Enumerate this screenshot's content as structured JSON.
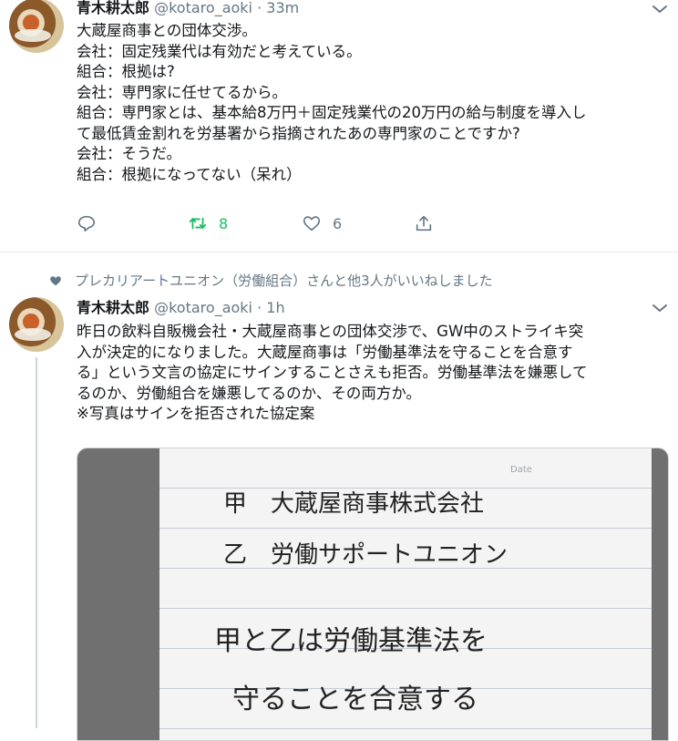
{
  "tweet1": {
    "name": "青木耕太郎",
    "handle": "@kotaro_aoki",
    "separator": "·",
    "time": "33m",
    "lines": [
      "大蔵屋商事との団体交渉。",
      "会社：固定残業代は有効だと考えている。",
      "組合：根拠は?",
      "会社：専門家に任せてるから。",
      "組合：専門家とは、基本給8万円＋固定残業代の20万円の給与制度を導入し",
      "て最低賃金割れを労基署から指摘されたあの専門家のことですか?",
      "会社：そうだ。",
      "組合：根拠になってない（呆れ）"
    ],
    "retweet_count": "8",
    "like_count": "6",
    "icons": [
      "chevron-down-icon",
      "reply-icon",
      "retweet-icon",
      "heart-icon",
      "share-icon"
    ],
    "retweet_color": "#17bf63"
  },
  "social_context": {
    "text": "プレカリアートユニオン（労働組合）さんと他3人がいいねしました",
    "icon": "heart-filled-icon"
  },
  "tweet2": {
    "name": "青木耕太郎",
    "handle": "@kotaro_aoki",
    "separator": "·",
    "time": "1h",
    "lines": [
      "昨日の飲料自販機会社・大蔵屋商事との団体交渉で、GW中のストライキ突",
      "入が決定的になりました。大蔵屋商事は「労働基準法を守ることを合意す",
      "る」という文言の協定にサインすることさえも拒否。労働基準法を嫌悪して",
      "るのか、労働組合を嫌悪してるのか、その両方か。",
      "※写真はサインを拒否された協定案"
    ],
    "photo": {
      "date_label": "Date",
      "handwritten_lines": [
        "甲　大蔵屋商事株式会社",
        "乙　労働サポートユニオン",
        "甲と乙は労働基準法を",
        "守ることを合意する"
      ]
    }
  },
  "colors": {
    "text_primary": "#14171a",
    "text_secondary": "#657786",
    "divider": "#e6ecf0"
  }
}
